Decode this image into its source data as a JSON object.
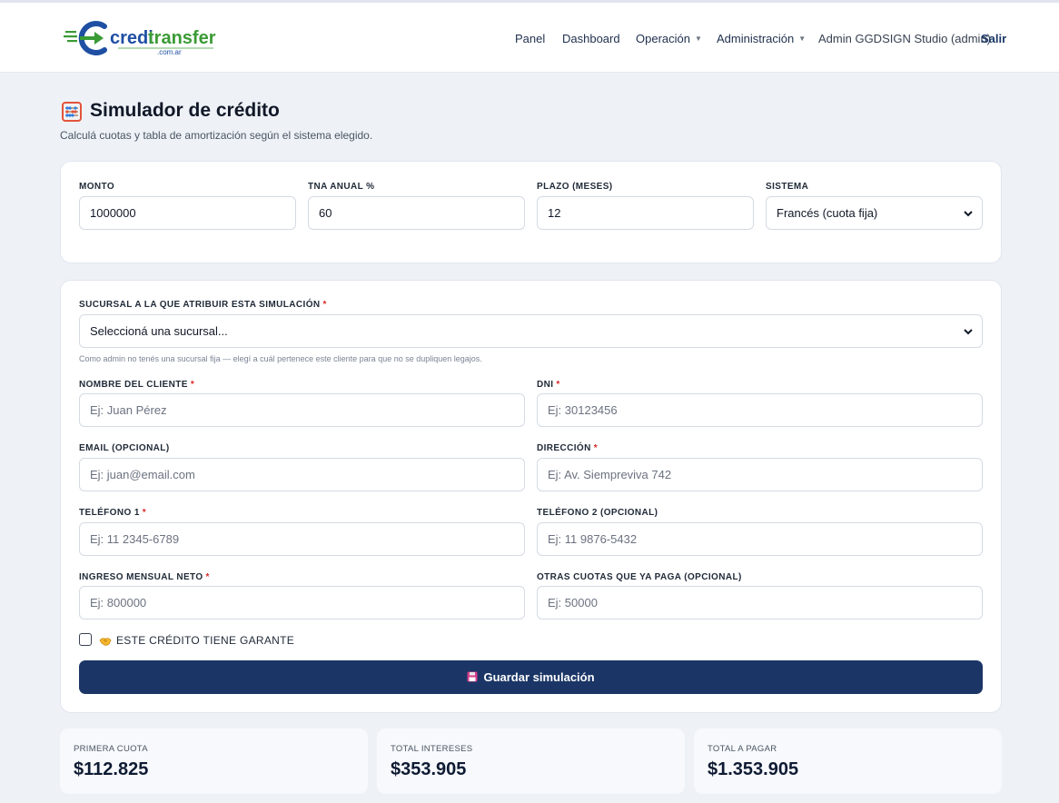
{
  "brand": {
    "name_part1": "credi",
    "name_part2": "transfer",
    "domain": ".com.ar",
    "colors": {
      "blue": "#1f4fa3",
      "green": "#3a9b35",
      "navy": "#1b3666"
    }
  },
  "nav": {
    "items": [
      {
        "label": "Panel",
        "dropdown": false
      },
      {
        "label": "Dashboard",
        "dropdown": false
      },
      {
        "label": "Operación",
        "dropdown": true
      },
      {
        "label": "Administración",
        "dropdown": true
      }
    ],
    "user": "Admin GGDSIGN Studio (admin)",
    "logout": "Salir"
  },
  "page": {
    "title_icon": "abacus-icon",
    "title": "Simulador de crédito",
    "subtitle": "Calculá cuotas y tabla de amortización según el sistema elegido."
  },
  "simulator": {
    "monto": {
      "label": "Monto",
      "value": "1000000"
    },
    "tna": {
      "label": "TNA anual %",
      "value": "60"
    },
    "plazo": {
      "label": "Plazo (meses)",
      "value": "12"
    },
    "sistema": {
      "label": "Sistema",
      "value": "Francés (cuota fija)"
    }
  },
  "client_form": {
    "sucursal": {
      "label": "Sucursal a la que atribuir esta simulación",
      "required_mark": "*",
      "value": "Seleccioná una sucursal...",
      "help": "Como admin no tenés una sucursal fija — elegí a cuál pertenece este cliente para que no se dupliquen legajos."
    },
    "nombre": {
      "label": "Nombre del cliente",
      "required_mark": "*",
      "placeholder": "Ej: Juan Pérez"
    },
    "dni": {
      "label": "DNI",
      "required_mark": "*",
      "placeholder": "Ej: 30123456"
    },
    "email": {
      "label": "Email (opcional)",
      "placeholder": "Ej: juan@email.com"
    },
    "direccion": {
      "label": "Dirección",
      "required_mark": "*",
      "placeholder": "Ej: Av. Siempreviva 742"
    },
    "telefono1": {
      "label": "Teléfono 1",
      "required_mark": "*",
      "placeholder": "Ej: 11 2345-6789"
    },
    "telefono2": {
      "label": "Teléfono 2 (opcional)",
      "placeholder": "Ej: 11 9876-5432"
    },
    "ingreso": {
      "label": "Ingreso mensual neto",
      "required_mark": "*",
      "placeholder": "Ej: 800000"
    },
    "otras_cuotas": {
      "label": "Otras cuotas que ya paga (opcional)",
      "placeholder": "Ej: 50000"
    },
    "garante": {
      "label": "Este crédito tiene garante",
      "checked": false,
      "icon": "handshake-icon"
    },
    "save_button": {
      "label": "Guardar simulación",
      "icon": "floppy-disk-icon"
    }
  },
  "summary": [
    {
      "label": "Primera cuota",
      "value": "$112.825"
    },
    {
      "label": "Total intereses",
      "value": "$353.905"
    },
    {
      "label": "Total a pagar",
      "value": "$1.353.905"
    }
  ]
}
